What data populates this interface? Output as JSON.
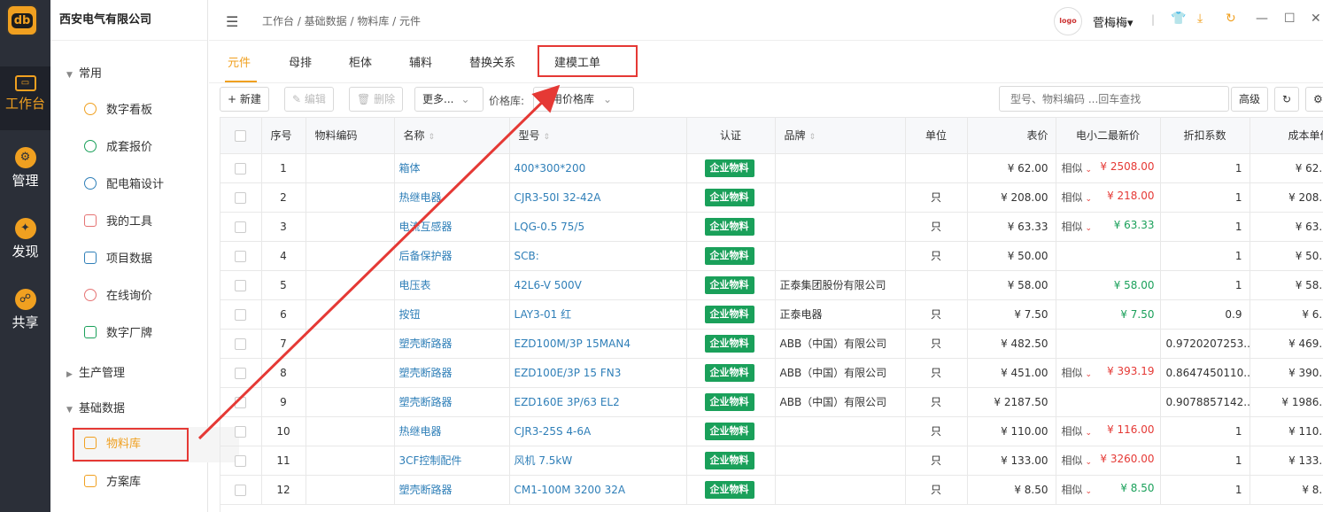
{
  "rail": {
    "logo": "db",
    "items": [
      {
        "label": "工作台",
        "icon": "monitor-icon"
      },
      {
        "label": "管理",
        "icon": "gear-icon"
      },
      {
        "label": "发现",
        "icon": "compass-icon"
      },
      {
        "label": "共享",
        "icon": "share-icon"
      }
    ]
  },
  "nav": {
    "company": "西安电气有限公司",
    "groups": {
      "common": "常用",
      "production": "生产管理",
      "basic_data": "基础数据"
    },
    "common_items": [
      "数字看板",
      "成套报价",
      "配电箱设计",
      "我的工具",
      "项目数据",
      "在线询价",
      "数字厂牌"
    ],
    "basic_items": [
      "物料库",
      "方案库"
    ]
  },
  "header": {
    "breadcrumb": "工作台 / 基础数据 / 物料库 / 元件",
    "avatar_text": "logo",
    "user": "菅梅梅",
    "user_chevron": "▾",
    "separator": "|"
  },
  "tabs": [
    "元件",
    "母排",
    "柜体",
    "辅料",
    "替换关系",
    "建模工单"
  ],
  "toolbar": {
    "new": "+ 新建",
    "edit": "编辑",
    "delete": "删除",
    "more": "更多...",
    "price_label": "价格库:",
    "price_value": "通用价格库",
    "search_placeholder": "型号、物料编码 ...回车查找",
    "advanced": "高级"
  },
  "table": {
    "headers": [
      "序号",
      "物料编码",
      "名称",
      "型号",
      "认证",
      "品牌",
      "单位",
      "表价",
      "电小二最新价",
      "折扣系数",
      "成本单价"
    ],
    "rows": [
      {
        "no": "1",
        "code": "",
        "name": "箱体",
        "model": "400*300*200",
        "cert": "企业物料",
        "brand": "",
        "unit": "",
        "price": "¥ 62.00",
        "sim": "相似",
        "latest": "¥ 2508.00",
        "latest_color": "red",
        "discount": "1",
        "cost": "¥ 62.00"
      },
      {
        "no": "2",
        "code": "",
        "name": "热继电器",
        "model": "CJR3-50I 32-42A",
        "cert": "企业物料",
        "brand": "",
        "unit": "只",
        "price": "¥ 208.00",
        "sim": "相似",
        "latest": "¥ 218.00",
        "latest_color": "red",
        "discount": "1",
        "cost": "¥ 208.00"
      },
      {
        "no": "3",
        "code": "",
        "name": "电流互感器",
        "model": "LQG-0.5 75/5",
        "cert": "企业物料",
        "brand": "",
        "unit": "只",
        "price": "¥ 63.33",
        "sim": "相似",
        "latest": "¥ 63.33",
        "latest_color": "green",
        "discount": "1",
        "cost": "¥ 63.33"
      },
      {
        "no": "4",
        "code": "",
        "name": "后备保护器",
        "model": "SCB:",
        "cert": "企业物料",
        "brand": "",
        "unit": "只",
        "price": "¥ 50.00",
        "sim": "",
        "latest": "",
        "latest_color": "",
        "discount": "1",
        "cost": "¥ 50.00"
      },
      {
        "no": "5",
        "code": "",
        "name": "电压表",
        "model": "42L6-V 500V",
        "cert": "企业物料",
        "brand": "正泰集团股份有限公司",
        "unit": "",
        "price": "¥ 58.00",
        "sim": "",
        "latest": "¥ 58.00",
        "latest_color": "green",
        "discount": "1",
        "cost": "¥ 58.00"
      },
      {
        "no": "6",
        "code": "",
        "name": "按钮",
        "model": "LAY3-01 红",
        "cert": "企业物料",
        "brand": "正泰电器",
        "unit": "只",
        "price": "¥ 7.50",
        "sim": "",
        "latest": "¥ 7.50",
        "latest_color": "green",
        "discount": "0.9",
        "cost": "¥ 6.75"
      },
      {
        "no": "7",
        "code": "",
        "name": "塑壳断路器",
        "model": "EZD100M/3P 15MAN4",
        "cert": "企业物料",
        "brand": "ABB（中国）有限公司",
        "unit": "只",
        "price": "¥ 482.50",
        "sim": "",
        "latest": "",
        "latest_color": "",
        "discount": "0.9720207253...",
        "cost": "¥ 469.00"
      },
      {
        "no": "8",
        "code": "",
        "name": "塑壳断路器",
        "model": "EZD100E/3P 15 FN3",
        "cert": "企业物料",
        "brand": "ABB（中国）有限公司",
        "unit": "只",
        "price": "¥ 451.00",
        "sim": "相似",
        "latest": "¥ 393.19",
        "latest_color": "red",
        "discount": "0.8647450110...",
        "cost": "¥ 390.00"
      },
      {
        "no": "9",
        "code": "",
        "name": "塑壳断路器",
        "model": "EZD160E 3P/63 EL2",
        "cert": "企业物料",
        "brand": "ABB（中国）有限公司",
        "unit": "只",
        "price": "¥ 2187.50",
        "sim": "",
        "latest": "",
        "latest_color": "",
        "discount": "0.9078857142...",
        "cost": "¥ 1986.00"
      },
      {
        "no": "10",
        "code": "",
        "name": "热继电器",
        "model": "CJR3-25S 4-6A",
        "cert": "企业物料",
        "brand": "",
        "unit": "只",
        "price": "¥ 110.00",
        "sim": "相似",
        "latest": "¥ 116.00",
        "latest_color": "red",
        "discount": "1",
        "cost": "¥ 110.00"
      },
      {
        "no": "11",
        "code": "",
        "name": "3CF控制配件",
        "model": "风机 7.5kW",
        "cert": "企业物料",
        "brand": "",
        "unit": "只",
        "price": "¥ 133.00",
        "sim": "相似",
        "latest": "¥ 3260.00",
        "latest_color": "red",
        "discount": "1",
        "cost": "¥ 133.00"
      },
      {
        "no": "12",
        "code": "",
        "name": "塑壳断路器",
        "model": "CM1-100M 3200 32A",
        "cert": "企业物料",
        "brand": "",
        "unit": "只",
        "price": "¥ 8.50",
        "sim": "相似",
        "latest": "¥ 8.50",
        "latest_color": "green",
        "discount": "1",
        "cost": "¥ 8.50"
      }
    ]
  },
  "colors": {
    "accent": "#f0a020",
    "link": "#2f7fb8",
    "badge": "#1aa05a",
    "annotation": "#e53935"
  }
}
